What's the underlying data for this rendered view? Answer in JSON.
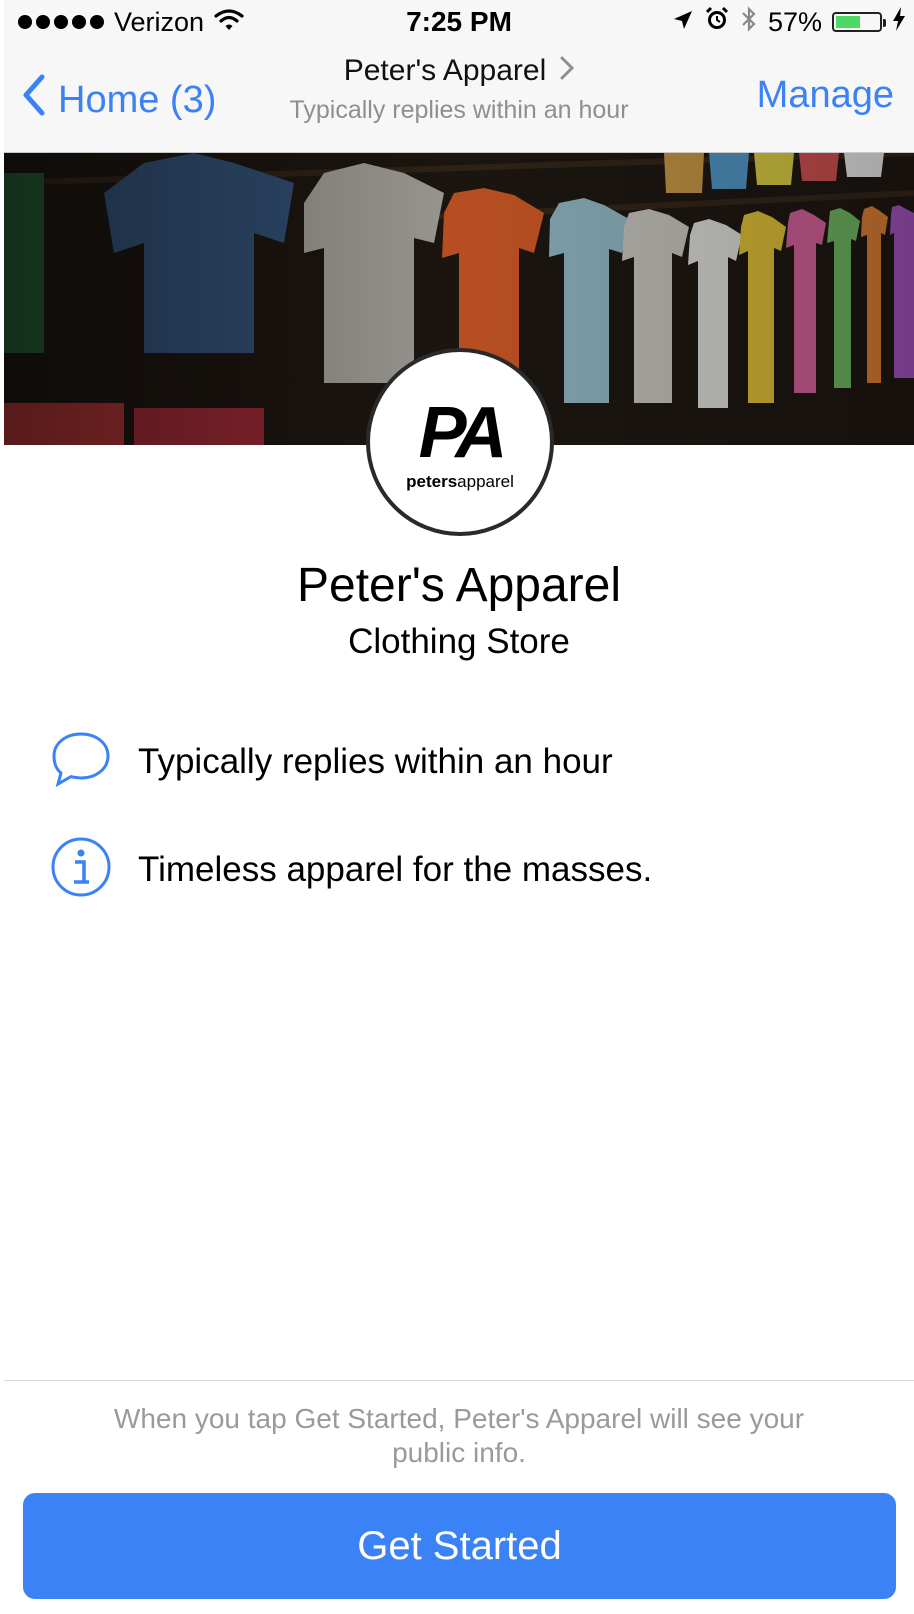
{
  "status_bar": {
    "carrier": "Verizon",
    "time": "7:25 PM",
    "battery_percent": "57%",
    "battery_level": 0.57,
    "icons": [
      "signal-dots-icon",
      "wifi-icon",
      "location-arrow-icon",
      "alarm-icon",
      "bluetooth-icon",
      "battery-icon",
      "charging-bolt-icon"
    ]
  },
  "nav": {
    "back_label": "Home (3)",
    "title": "Peter's Apparel",
    "subtitle": "Typically replies within an hour",
    "manage_label": "Manage"
  },
  "profile": {
    "logo_monogram": "PA",
    "logo_wordmark_bold": "peters",
    "logo_wordmark_light": "apparel",
    "name": "Peter's Apparel",
    "category": "Clothing Store"
  },
  "details": [
    {
      "icon": "chat-bubble-icon",
      "text": "Typically replies within an hour"
    },
    {
      "icon": "info-icon",
      "text": "Timeless apparel for the masses."
    }
  ],
  "footer": {
    "disclaimer": "When you tap Get Started, Peter's Apparel will see your public info.",
    "button_label": "Get Started"
  },
  "colors": {
    "accent": "#3b82f6",
    "battery_fill": "#4cd964",
    "secondary_text": "#8e8e93"
  }
}
